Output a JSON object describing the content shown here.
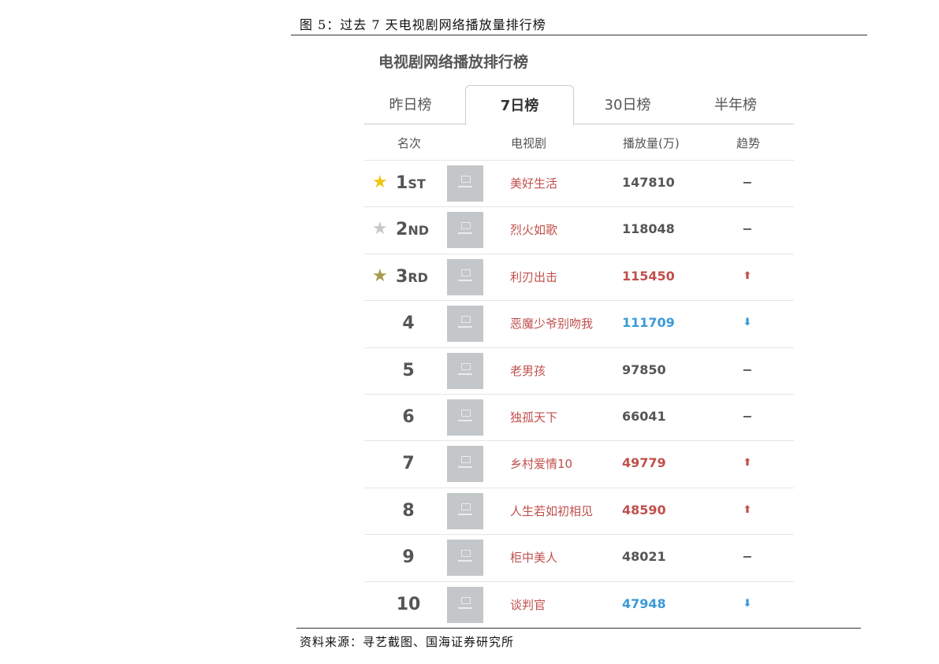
{
  "caption": "图 5：过去 7 天电视剧网络播放量排行榜",
  "source": "资料来源：寻艺截图、国海证券研究所",
  "widget": {
    "title": "电视剧网络播放排行榜",
    "tabs": [
      {
        "label": "昨日榜",
        "active": false
      },
      {
        "label": "7日榜",
        "active": true
      },
      {
        "label": "30日榜",
        "active": false
      },
      {
        "label": "半年榜",
        "active": false
      }
    ],
    "columns": {
      "rank": "名次",
      "drama": "电视剧",
      "plays": "播放量(万)",
      "trend": "趋势"
    },
    "colors": {
      "gold": "#f2c40f",
      "silver": "#c8c8c8",
      "bronze": "#a89a4c",
      "up": "#c0504d",
      "down": "#3a9ad9"
    },
    "rows": [
      {
        "rank": "1",
        "suffix": "ST",
        "star": "gold",
        "name": "美好生活",
        "plays": "147810",
        "trend": "same"
      },
      {
        "rank": "2",
        "suffix": "ND",
        "star": "silver",
        "name": "烈火如歌",
        "plays": "118048",
        "trend": "same"
      },
      {
        "rank": "3",
        "suffix": "RD",
        "star": "bronze",
        "name": "利刃出击",
        "plays": "115450",
        "trend": "up"
      },
      {
        "rank": "4",
        "suffix": "",
        "star": "",
        "name": "恶魔少爷别吻我",
        "plays": "111709",
        "trend": "down"
      },
      {
        "rank": "5",
        "suffix": "",
        "star": "",
        "name": "老男孩",
        "plays": "97850",
        "trend": "same"
      },
      {
        "rank": "6",
        "suffix": "",
        "star": "",
        "name": "独孤天下",
        "plays": "66041",
        "trend": "same"
      },
      {
        "rank": "7",
        "suffix": "",
        "star": "",
        "name": "乡村爱情10",
        "plays": "49779",
        "trend": "up"
      },
      {
        "rank": "8",
        "suffix": "",
        "star": "",
        "name": "人生若如初相见",
        "plays": "48590",
        "trend": "up"
      },
      {
        "rank": "9",
        "suffix": "",
        "star": "",
        "name": "柜中美人",
        "plays": "48021",
        "trend": "same"
      },
      {
        "rank": "10",
        "suffix": "",
        "star": "",
        "name": "谈判官",
        "plays": "47948",
        "trend": "down"
      }
    ]
  }
}
